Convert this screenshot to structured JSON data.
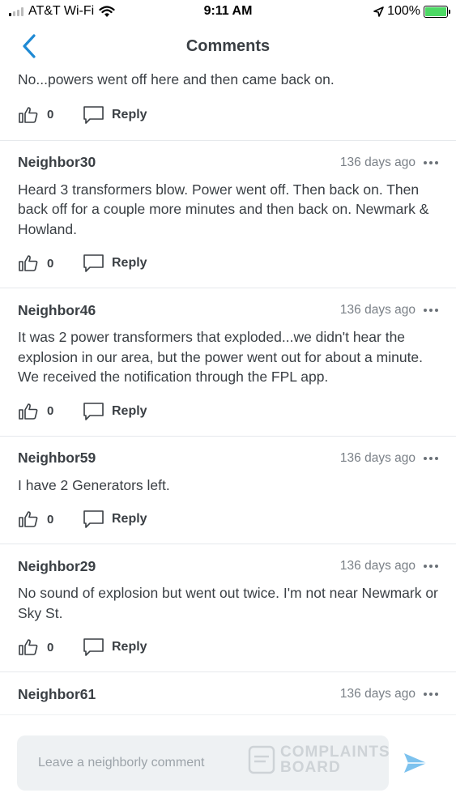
{
  "status": {
    "carrier": "AT&T Wi-Fi",
    "time": "9:11 AM",
    "battery": "100%"
  },
  "header": {
    "title": "Comments"
  },
  "colors": {
    "accent": "#1f8ad4",
    "text": "#3a3f44",
    "muted": "#7a8087",
    "battery": "#4cd964"
  },
  "comments": [
    {
      "name": "",
      "time": "",
      "text": "No...powers went off here and then came back on.",
      "likes": "0",
      "reply": "Reply"
    },
    {
      "name": "Neighbor30",
      "time": "136 days ago",
      "text": "Heard 3 transformers blow. Power went off. Then back on. Then back off for a couple more minutes and then back on. Newmark & Howland.",
      "likes": "0",
      "reply": "Reply"
    },
    {
      "name": "Neighbor46",
      "time": "136 days ago",
      "text": "It was 2 power transformers that exploded...we didn't hear the explosion in our area, but the power went out for about a minute.  We received the notification through the FPL app.",
      "likes": "0",
      "reply": "Reply"
    },
    {
      "name": "Neighbor59",
      "time": "136 days ago",
      "text": "I have 2 Generators left.",
      "likes": "0",
      "reply": "Reply"
    },
    {
      "name": "Neighbor29",
      "time": "136 days ago",
      "text": "No sound of explosion but went out  twice. I'm not near Newmark or Sky St.",
      "likes": "0",
      "reply": "Reply"
    },
    {
      "name": "Neighbor61",
      "time": "136 days ago",
      "text": "",
      "likes": "",
      "reply": ""
    }
  ],
  "input": {
    "placeholder": "Leave a neighborly comment"
  },
  "watermark": {
    "line1": "COMPLAINTS",
    "line2": "BOARD"
  }
}
